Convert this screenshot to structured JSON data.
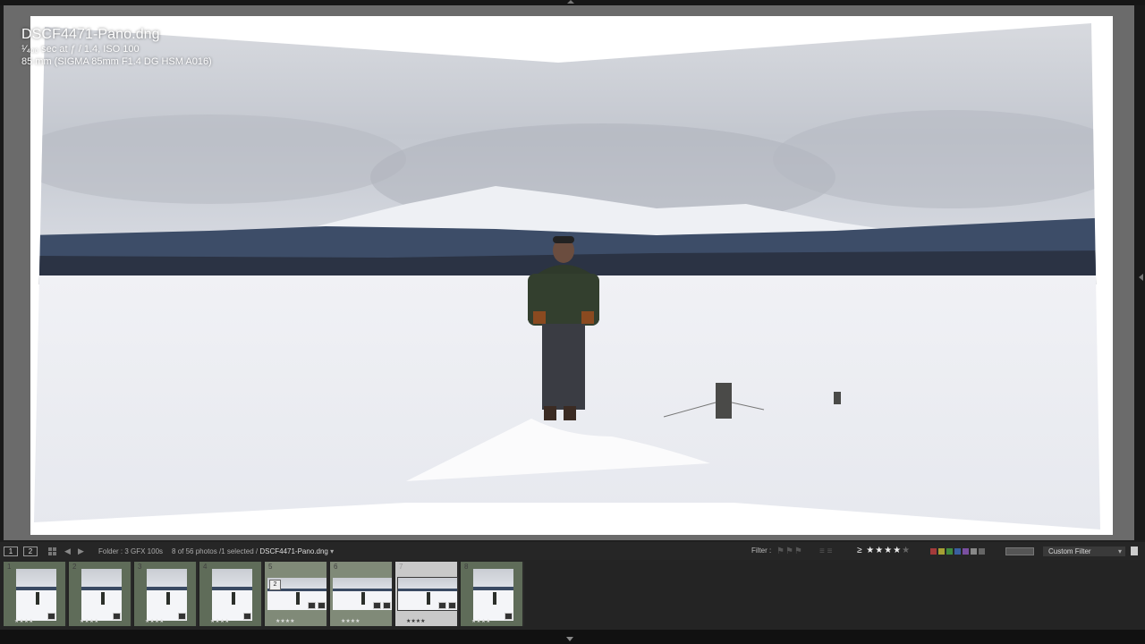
{
  "photo": {
    "title": "DSCF4471-Pano.dng",
    "exposure": "¹⁄₄₀₀ sec at ƒ / 1.4, ISO 100",
    "lens": "85 mm (SIGMA 85mm F1.4 DG HSM A016)"
  },
  "toolbar": {
    "screen1": "1",
    "screen2": "2",
    "folder_label": "Folder : 3 GFX 100s",
    "count_label": "8 of 56 photos /1 selected /",
    "current_file": "DSCF4471-Pano.dng",
    "filter_label": "Filter :",
    "rating_prefix": "≥",
    "rating_value": 4,
    "rating_max": 5,
    "custom_filter": "Custom Filter",
    "color_labels": [
      "#a33a3a",
      "#a6a034",
      "#3f8a3f",
      "#3a5fa0",
      "#7a4fa0",
      "#888888",
      "#666666"
    ]
  },
  "filmstrip": {
    "items": [
      {
        "number": "1",
        "stars": "★★★★",
        "type": "portrait"
      },
      {
        "number": "2",
        "stars": "★★★★",
        "type": "portrait"
      },
      {
        "number": "3",
        "stars": "★★★★",
        "type": "portrait"
      },
      {
        "number": "4",
        "stars": "★★★★",
        "type": "portrait"
      },
      {
        "number": "5",
        "stars": "★★★★",
        "type": "pano",
        "stack": "2"
      },
      {
        "number": "6",
        "stars": "★★★★",
        "type": "pano"
      },
      {
        "number": "7",
        "stars": "★★★★",
        "type": "pano-selected"
      },
      {
        "number": "8",
        "stars": "★★★★",
        "type": "portrait"
      }
    ]
  }
}
